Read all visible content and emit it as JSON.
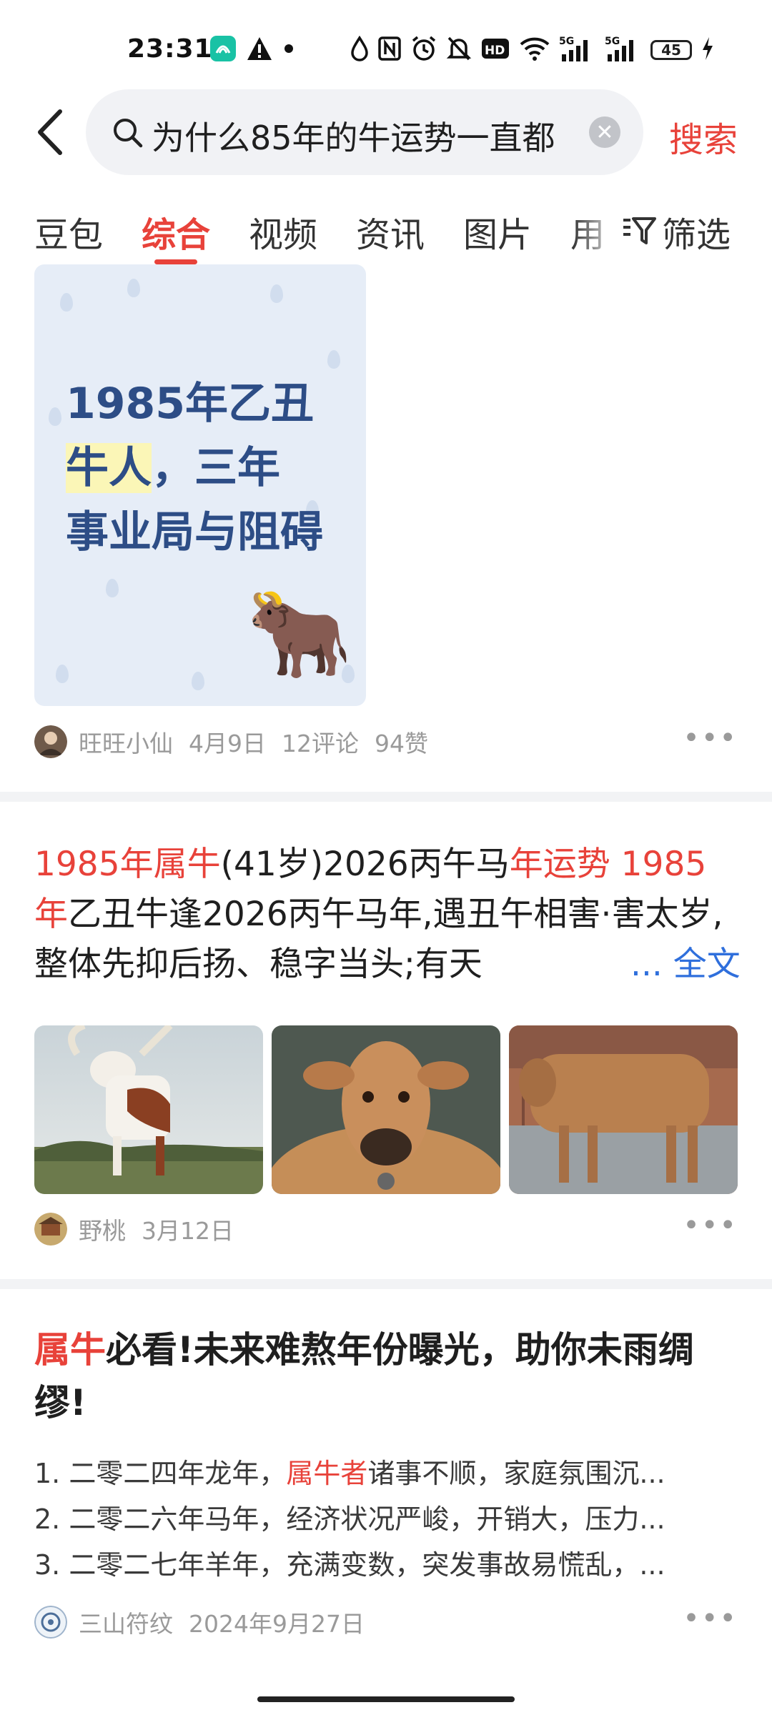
{
  "status_bar": {
    "time": "23:31",
    "battery": "45",
    "icons": [
      "app-icon",
      "warning-icon",
      "dot-icon",
      "drop-icon",
      "nfc-icon",
      "alarm-icon",
      "mute-icon",
      "hd-icon",
      "wifi-icon",
      "signal-5g-icon",
      "signal-5g-icon",
      "battery-icon",
      "charging-icon"
    ]
  },
  "search": {
    "query": "为什么85年的牛运势一直都",
    "button": "搜索"
  },
  "tabs": {
    "items": [
      "豆包",
      "综合",
      "视频",
      "资讯",
      "图片",
      "用"
    ],
    "active": "综合",
    "filter": "筛选"
  },
  "result1": {
    "cover_lines": [
      "1985年乙丑",
      "牛人",
      "，三年",
      "事业局与阻碍"
    ],
    "cover_emoji": "🐂",
    "author": "旺旺小仙",
    "date": "4月9日",
    "comments": "12评论",
    "likes": "94赞"
  },
  "result2": {
    "title_parts": [
      {
        "text": "1985年属牛",
        "hl": true
      },
      {
        "text": "(41岁)2026丙午马",
        "hl": false
      },
      {
        "text": "年运势 1985年",
        "hl": true
      },
      {
        "text": "乙丑牛逢2026丙午马年,遇丑午相害·害太岁,整体先抑后扬、稳字当头;有天",
        "hl": false
      }
    ],
    "more": "... 全文",
    "author": "野桃",
    "date": "3月12日"
  },
  "result3": {
    "title_hl": "属牛",
    "title_rest": "必看!未来难熬年份曝光，助你未雨绸缪!",
    "lines": [
      {
        "pre": "1. 二零二四年龙年，",
        "hl": "属牛者",
        "post": "诸事不顺，家庭氛围沉..."
      },
      {
        "pre": "2. 二零二六年马年，经济状况严峻，开销大，压力...",
        "hl": "",
        "post": ""
      },
      {
        "pre": "3. 二零二七年羊年，充满变数，突发事故易慌乱，...",
        "hl": "",
        "post": ""
      }
    ],
    "author": "三山符纹",
    "date": "2024年9月27日"
  },
  "colors": {
    "accent": "#e8423a",
    "link": "#2f6fdc",
    "cover_bg": "#e6edf7",
    "cover_text": "#2d4d86"
  }
}
